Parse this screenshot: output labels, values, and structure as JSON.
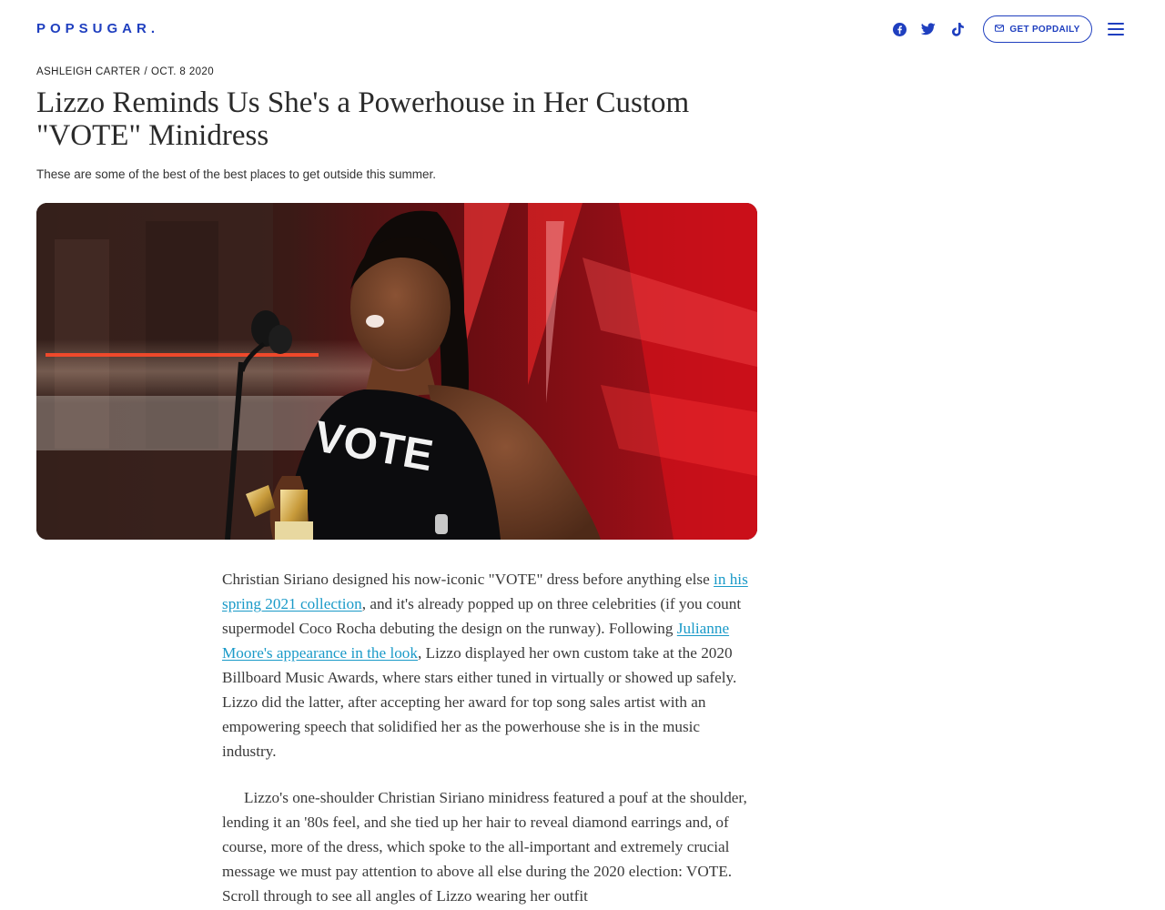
{
  "header": {
    "logo": "POPSUGAR.",
    "social": [
      "facebook-icon",
      "twitter-icon",
      "tiktok-icon"
    ],
    "newsletter_label": "GET POPDAILY",
    "menu_icon": "hamburger-menu-icon"
  },
  "article": {
    "author": "ASHLEIGH CARTER",
    "separator": "/",
    "date": "OCT. 8 2020",
    "title": "Lizzo Reminds Us She's a Powerhouse in Her Custom \"VOTE\" Minidress",
    "dek": "These are some of the best of the best places to get outside this summer.",
    "hero_text": "VOTE",
    "paragraphs": [
      {
        "parts": [
          {
            "type": "text",
            "value": "Christian Siriano designed his now-iconic \"VOTE\" dress before anything else "
          },
          {
            "type": "link",
            "value": "in his spring 2021 collection"
          },
          {
            "type": "text",
            "value": ", and it's already popped up on three celebrities (if you count supermodel Coco Rocha debuting the design on the runway). Following "
          },
          {
            "type": "link",
            "value": "Julianne Moore's appearance in the look"
          },
          {
            "type": "text",
            "value": ", Lizzo displayed her own custom take at the 2020 Billboard Music Awards, where stars either tuned in virtually or showed up safely. Lizzo did the latter, after accepting her award for top song sales artist with an empowering speech that solidified her as the powerhouse she is in the music industry."
          }
        ]
      },
      {
        "parts": [
          {
            "type": "text",
            "value": "Lizzo's one-shoulder Christian Siriano minidress featured a pouf at the shoulder, lending it an '80s feel, and she tied up her hair to reveal diamond earrings and, of course, more of the dress, which spoke to the all-important and extremely crucial message we must pay attention to above all else during the 2020 election: VOTE. Scroll through to see all angles of Lizzo wearing her outfit"
          }
        ]
      }
    ]
  },
  "colors": {
    "brand": "#1f3fbf",
    "link": "#1a9ac8",
    "hero_red": "#c0141c"
  }
}
